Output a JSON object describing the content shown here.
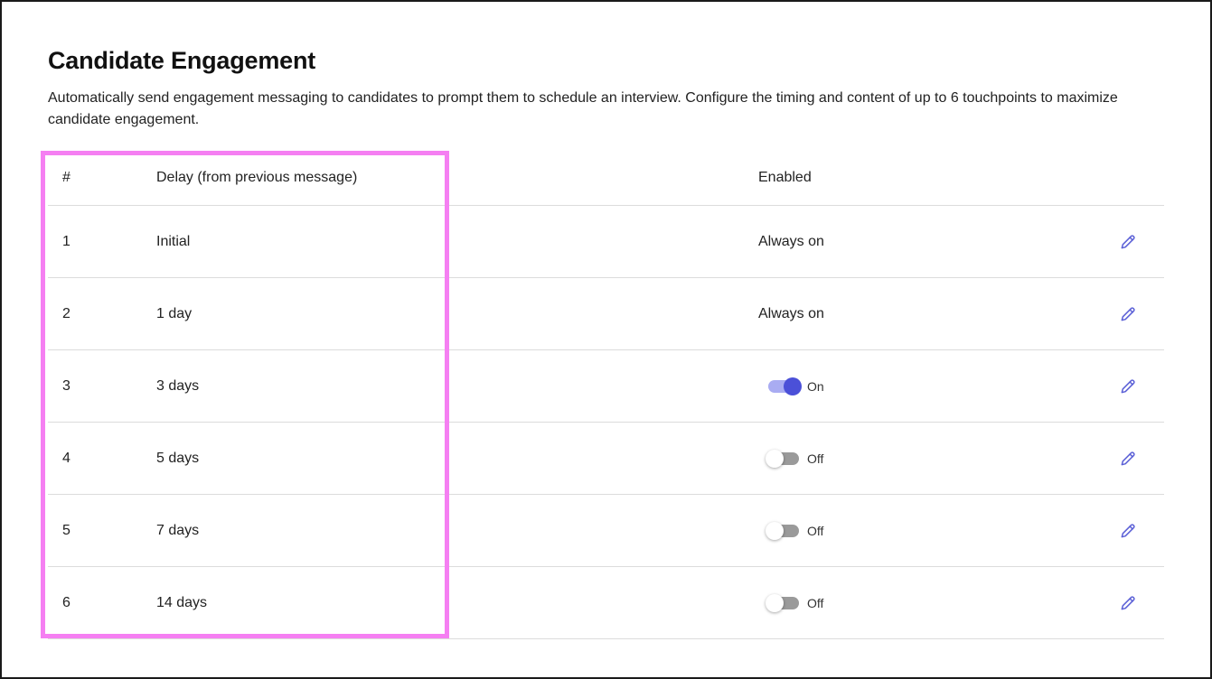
{
  "page": {
    "title": "Candidate Engagement",
    "description": "Automatically send engagement messaging to candidates to prompt them to schedule an interview. Configure the timing and content of up to 6 touchpoints to maximize candidate engagement."
  },
  "table": {
    "headers": {
      "num": "#",
      "delay": "Delay (from previous message)",
      "enabled": "Enabled"
    },
    "rows": [
      {
        "num": "1",
        "delay": "Initial",
        "enabled_type": "text",
        "enabled_text": "Always on"
      },
      {
        "num": "2",
        "delay": "1 day",
        "enabled_type": "text",
        "enabled_text": "Always on"
      },
      {
        "num": "3",
        "delay": "3 days",
        "enabled_type": "toggle",
        "enabled_on": true,
        "enabled_text": "On"
      },
      {
        "num": "4",
        "delay": "5 days",
        "enabled_type": "toggle",
        "enabled_on": false,
        "enabled_text": "Off"
      },
      {
        "num": "5",
        "delay": "7 days",
        "enabled_type": "toggle",
        "enabled_on": false,
        "enabled_text": "Off"
      },
      {
        "num": "6",
        "delay": "14 days",
        "enabled_type": "toggle",
        "enabled_on": false,
        "enabled_text": "Off"
      }
    ]
  },
  "icons": {
    "edit": "pencil-icon"
  },
  "colors": {
    "accent": "#4b50d8",
    "highlight": "#f57ff2",
    "toggle_off": "#9a9a9a",
    "edit_icon": "#5a5fd6"
  }
}
